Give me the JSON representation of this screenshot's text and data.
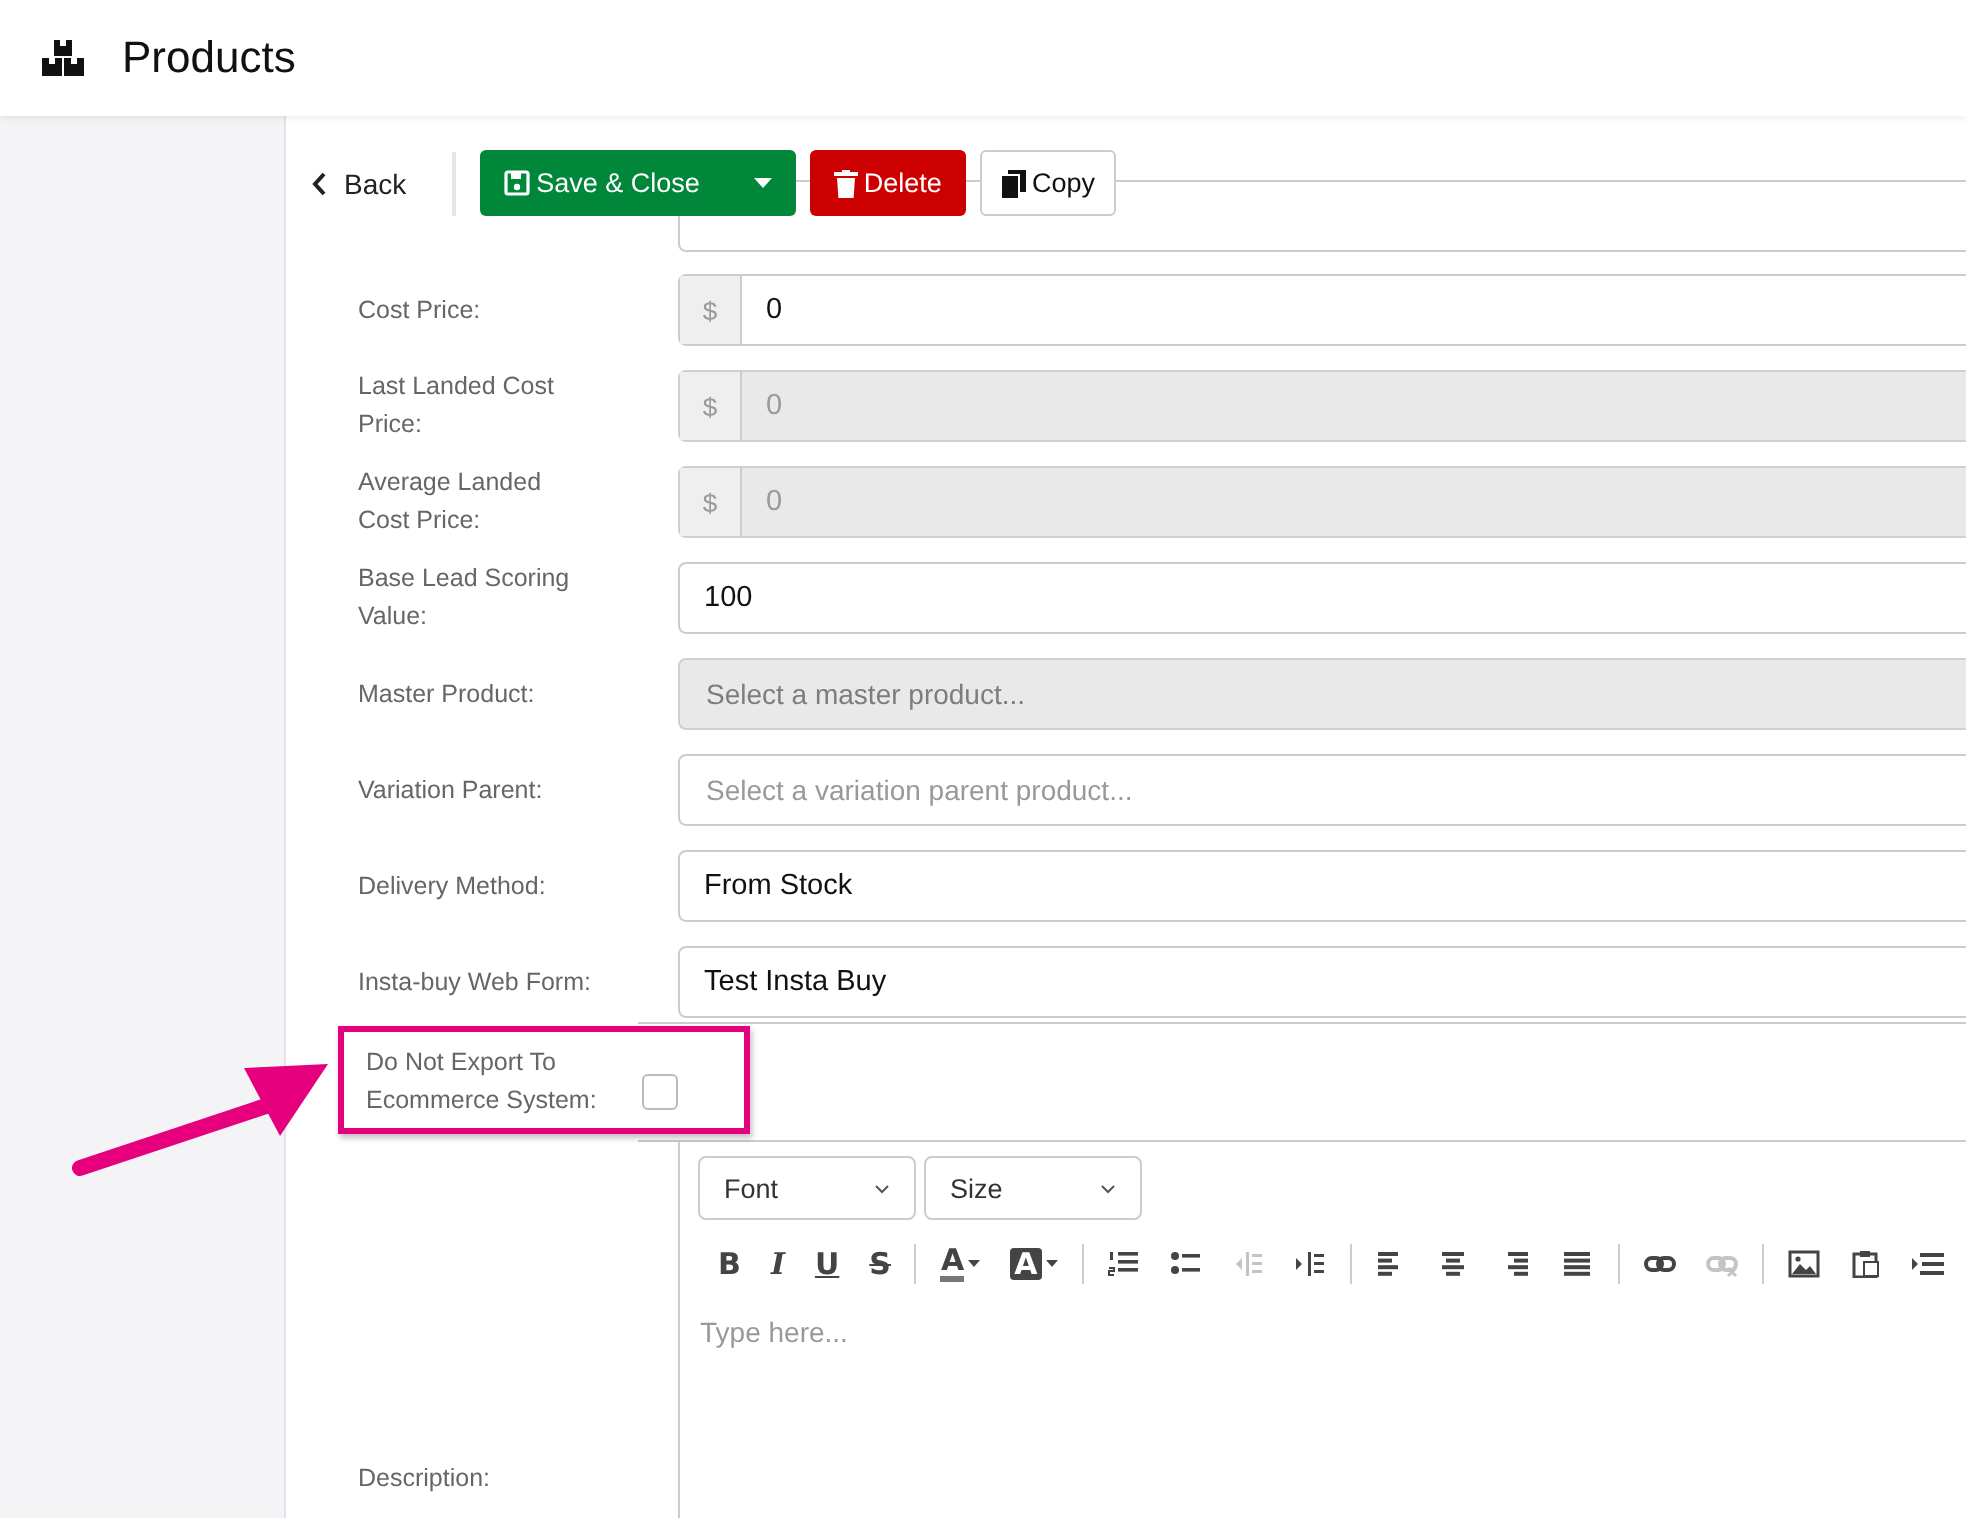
{
  "header": {
    "title": "Products"
  },
  "toolbar": {
    "back": "Back",
    "save": "Save & Close",
    "delete": "Delete",
    "copy": "Copy"
  },
  "fields": [
    {
      "label": "Cost Price:",
      "kind": "money",
      "prefix": "$",
      "value": "0",
      "disabled": false
    },
    {
      "label": "Last Landed Cost Price:",
      "kind": "money",
      "prefix": "$",
      "value": "0",
      "disabled": true
    },
    {
      "label": "Average Landed Cost Price:",
      "kind": "money",
      "prefix": "$",
      "value": "0",
      "disabled": true
    },
    {
      "label": "Base Lead Scoring Value:",
      "kind": "text",
      "value": "100",
      "disabled": false
    },
    {
      "label": "Master Product:",
      "kind": "select",
      "placeholder": "Select a master product...",
      "disabled": true
    },
    {
      "label": "Variation Parent:",
      "kind": "select",
      "placeholder": "Select a variation parent product...",
      "disabled": false
    },
    {
      "label": "Delivery Method:",
      "kind": "select",
      "value": "From Stock",
      "disabled": false
    },
    {
      "label": "Insta-buy Web Form:",
      "kind": "select",
      "value": "Test Insta Buy",
      "disabled": false
    }
  ],
  "export_option": {
    "label": "Do Not Export To Ecommerce System:",
    "checked": false,
    "highlighted": true
  },
  "editor": {
    "label": "Description:",
    "font": "Font",
    "size": "Size",
    "placeholder": "Type here...",
    "tool_groups": [
      [
        {
          "kind": "bold",
          "label": "B",
          "disabled": false
        },
        {
          "kind": "italic",
          "label": "I",
          "disabled": false
        },
        {
          "kind": "underline",
          "label": "U",
          "disabled": false
        },
        {
          "kind": "strike",
          "label": "S",
          "disabled": false
        }
      ],
      [
        {
          "kind": "color",
          "label": "A",
          "disabled": false
        },
        {
          "kind": "highlight",
          "label": "A",
          "disabled": false
        }
      ],
      [
        {
          "kind": "ordered-list",
          "disabled": false
        },
        {
          "kind": "bullet-list",
          "disabled": false
        },
        {
          "kind": "outdent",
          "disabled": true
        },
        {
          "kind": "indent",
          "disabled": false
        }
      ],
      [
        {
          "kind": "align-left",
          "disabled": false
        },
        {
          "kind": "align-center",
          "disabled": false
        },
        {
          "kind": "align-right",
          "disabled": false
        },
        {
          "kind": "justify",
          "disabled": false
        }
      ],
      [
        {
          "kind": "link",
          "disabled": false
        },
        {
          "kind": "unlink",
          "disabled": true
        }
      ],
      [
        {
          "kind": "image",
          "disabled": false
        },
        {
          "kind": "paste",
          "disabled": false
        },
        {
          "kind": "more",
          "disabled": false
        }
      ]
    ]
  }
}
